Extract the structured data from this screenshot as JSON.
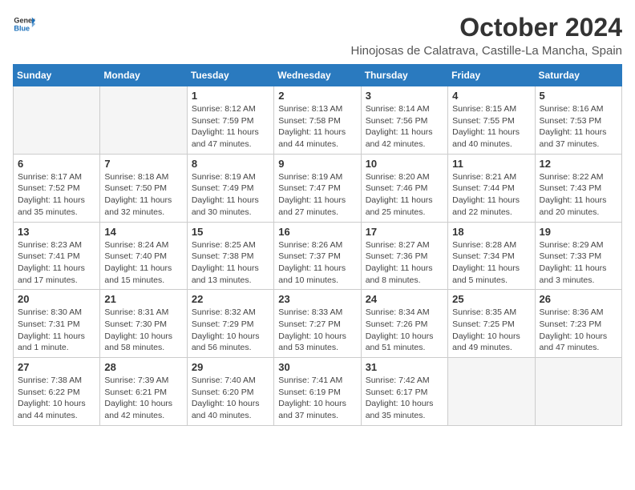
{
  "header": {
    "logo_line1": "General",
    "logo_line2": "Blue",
    "title": "October 2024",
    "subtitle": "Hinojosas de Calatrava, Castille-La Mancha, Spain"
  },
  "days_of_week": [
    "Sunday",
    "Monday",
    "Tuesday",
    "Wednesday",
    "Thursday",
    "Friday",
    "Saturday"
  ],
  "weeks": [
    [
      {
        "day": "",
        "info": ""
      },
      {
        "day": "",
        "info": ""
      },
      {
        "day": "1",
        "info": "Sunrise: 8:12 AM\nSunset: 7:59 PM\nDaylight: 11 hours and 47 minutes."
      },
      {
        "day": "2",
        "info": "Sunrise: 8:13 AM\nSunset: 7:58 PM\nDaylight: 11 hours and 44 minutes."
      },
      {
        "day": "3",
        "info": "Sunrise: 8:14 AM\nSunset: 7:56 PM\nDaylight: 11 hours and 42 minutes."
      },
      {
        "day": "4",
        "info": "Sunrise: 8:15 AM\nSunset: 7:55 PM\nDaylight: 11 hours and 40 minutes."
      },
      {
        "day": "5",
        "info": "Sunrise: 8:16 AM\nSunset: 7:53 PM\nDaylight: 11 hours and 37 minutes."
      }
    ],
    [
      {
        "day": "6",
        "info": "Sunrise: 8:17 AM\nSunset: 7:52 PM\nDaylight: 11 hours and 35 minutes."
      },
      {
        "day": "7",
        "info": "Sunrise: 8:18 AM\nSunset: 7:50 PM\nDaylight: 11 hours and 32 minutes."
      },
      {
        "day": "8",
        "info": "Sunrise: 8:19 AM\nSunset: 7:49 PM\nDaylight: 11 hours and 30 minutes."
      },
      {
        "day": "9",
        "info": "Sunrise: 8:19 AM\nSunset: 7:47 PM\nDaylight: 11 hours and 27 minutes."
      },
      {
        "day": "10",
        "info": "Sunrise: 8:20 AM\nSunset: 7:46 PM\nDaylight: 11 hours and 25 minutes."
      },
      {
        "day": "11",
        "info": "Sunrise: 8:21 AM\nSunset: 7:44 PM\nDaylight: 11 hours and 22 minutes."
      },
      {
        "day": "12",
        "info": "Sunrise: 8:22 AM\nSunset: 7:43 PM\nDaylight: 11 hours and 20 minutes."
      }
    ],
    [
      {
        "day": "13",
        "info": "Sunrise: 8:23 AM\nSunset: 7:41 PM\nDaylight: 11 hours and 17 minutes."
      },
      {
        "day": "14",
        "info": "Sunrise: 8:24 AM\nSunset: 7:40 PM\nDaylight: 11 hours and 15 minutes."
      },
      {
        "day": "15",
        "info": "Sunrise: 8:25 AM\nSunset: 7:38 PM\nDaylight: 11 hours and 13 minutes."
      },
      {
        "day": "16",
        "info": "Sunrise: 8:26 AM\nSunset: 7:37 PM\nDaylight: 11 hours and 10 minutes."
      },
      {
        "day": "17",
        "info": "Sunrise: 8:27 AM\nSunset: 7:36 PM\nDaylight: 11 hours and 8 minutes."
      },
      {
        "day": "18",
        "info": "Sunrise: 8:28 AM\nSunset: 7:34 PM\nDaylight: 11 hours and 5 minutes."
      },
      {
        "day": "19",
        "info": "Sunrise: 8:29 AM\nSunset: 7:33 PM\nDaylight: 11 hours and 3 minutes."
      }
    ],
    [
      {
        "day": "20",
        "info": "Sunrise: 8:30 AM\nSunset: 7:31 PM\nDaylight: 11 hours and 1 minute."
      },
      {
        "day": "21",
        "info": "Sunrise: 8:31 AM\nSunset: 7:30 PM\nDaylight: 10 hours and 58 minutes."
      },
      {
        "day": "22",
        "info": "Sunrise: 8:32 AM\nSunset: 7:29 PM\nDaylight: 10 hours and 56 minutes."
      },
      {
        "day": "23",
        "info": "Sunrise: 8:33 AM\nSunset: 7:27 PM\nDaylight: 10 hours and 53 minutes."
      },
      {
        "day": "24",
        "info": "Sunrise: 8:34 AM\nSunset: 7:26 PM\nDaylight: 10 hours and 51 minutes."
      },
      {
        "day": "25",
        "info": "Sunrise: 8:35 AM\nSunset: 7:25 PM\nDaylight: 10 hours and 49 minutes."
      },
      {
        "day": "26",
        "info": "Sunrise: 8:36 AM\nSunset: 7:23 PM\nDaylight: 10 hours and 47 minutes."
      }
    ],
    [
      {
        "day": "27",
        "info": "Sunrise: 7:38 AM\nSunset: 6:22 PM\nDaylight: 10 hours and 44 minutes."
      },
      {
        "day": "28",
        "info": "Sunrise: 7:39 AM\nSunset: 6:21 PM\nDaylight: 10 hours and 42 minutes."
      },
      {
        "day": "29",
        "info": "Sunrise: 7:40 AM\nSunset: 6:20 PM\nDaylight: 10 hours and 40 minutes."
      },
      {
        "day": "30",
        "info": "Sunrise: 7:41 AM\nSunset: 6:19 PM\nDaylight: 10 hours and 37 minutes."
      },
      {
        "day": "31",
        "info": "Sunrise: 7:42 AM\nSunset: 6:17 PM\nDaylight: 10 hours and 35 minutes."
      },
      {
        "day": "",
        "info": ""
      },
      {
        "day": "",
        "info": ""
      }
    ]
  ]
}
